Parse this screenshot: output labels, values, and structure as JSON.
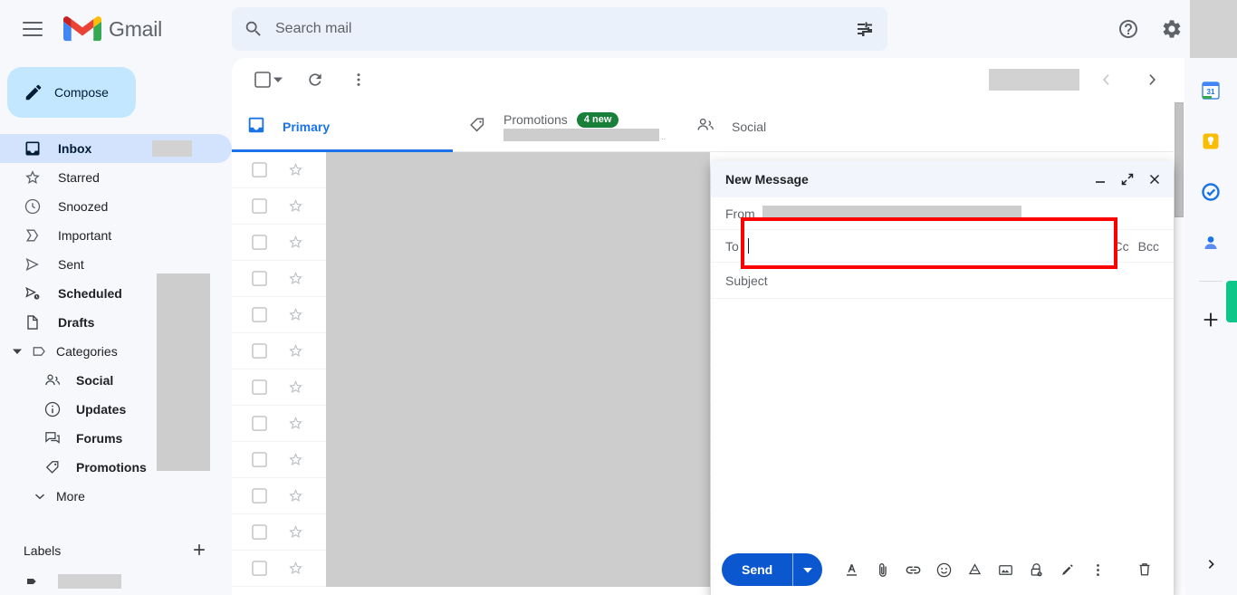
{
  "app": {
    "brand": "Gmail"
  },
  "search": {
    "placeholder": "Search mail",
    "value": "",
    "icon": "search-icon",
    "filter_icon": "tune-filter-icon"
  },
  "top_right": {
    "help_icon": "help-circle-icon",
    "settings_icon": "gear-icon",
    "apps_icon": "apps-grid-icon"
  },
  "sidebar": {
    "menu_icon": "hamburger-menu-icon",
    "compose": {
      "label": "Compose",
      "icon": "pencil-icon"
    },
    "items": [
      {
        "label": "Inbox",
        "icon": "inbox-icon",
        "active": true,
        "bold": true,
        "redacted_count": true
      },
      {
        "label": "Starred",
        "icon": "star-outline-icon",
        "active": false,
        "bold": false
      },
      {
        "label": "Snoozed",
        "icon": "clock-icon",
        "active": false,
        "bold": false
      },
      {
        "label": "Important",
        "icon": "important-marker-icon",
        "active": false,
        "bold": false
      },
      {
        "label": "Sent",
        "icon": "send-arrow-icon",
        "active": false,
        "bold": false
      },
      {
        "label": "Scheduled",
        "icon": "scheduled-send-icon",
        "active": false,
        "bold": true
      },
      {
        "label": "Drafts",
        "icon": "draft-document-icon",
        "active": false,
        "bold": true
      }
    ],
    "categories": {
      "label": "Categories",
      "icon": "label-tag-icon",
      "caret": "caret-down-icon"
    },
    "subitems": [
      {
        "label": "Social",
        "icon": "people-icon"
      },
      {
        "label": "Updates",
        "icon": "info-circle-icon"
      },
      {
        "label": "Forums",
        "icon": "forum-icon"
      },
      {
        "label": "Promotions",
        "icon": "label-tag-icon"
      }
    ],
    "more": {
      "label": "More",
      "icon": "chevron-down-icon"
    },
    "labels_header": {
      "label": "Labels",
      "add_icon": "plus-icon"
    },
    "label_row": {
      "icon": "label-solid-icon"
    }
  },
  "list_toolbar": {
    "select_all": {
      "checkbox_icon": "checkbox-empty-icon",
      "caret_icon": "caret-down-icon"
    },
    "refresh_icon": "refresh-icon",
    "more_icon": "more-vertical-icon",
    "prev_icon": "chevron-left-icon",
    "next_icon": "chevron-right-icon"
  },
  "tabs": [
    {
      "label": "Primary",
      "icon": "inbox-tab-icon",
      "active": true,
      "badge": "",
      "has_sub": false
    },
    {
      "label": "Promotions",
      "icon": "label-tag-icon",
      "active": false,
      "badge": "4 new",
      "has_sub": true,
      "sub_dots": ".."
    },
    {
      "label": "Social",
      "icon": "people-icon",
      "active": false,
      "badge": "",
      "has_sub": false
    }
  ],
  "mail_rows": [
    {
      "checkbox_icon": "checkbox-empty-icon",
      "star_icon": "star-outline-icon",
      "important_icon": "important-marker-icon"
    },
    {
      "checkbox_icon": "checkbox-empty-icon",
      "star_icon": "star-outline-icon",
      "important_icon": "important-marker-icon"
    },
    {
      "checkbox_icon": "checkbox-empty-icon",
      "star_icon": "star-outline-icon",
      "important_icon": "important-marker-icon"
    },
    {
      "checkbox_icon": "checkbox-empty-icon",
      "star_icon": "star-outline-icon",
      "important_icon": "important-marker-icon"
    },
    {
      "checkbox_icon": "checkbox-empty-icon",
      "star_icon": "star-outline-icon",
      "important_icon": "important-marker-icon"
    },
    {
      "checkbox_icon": "checkbox-empty-icon",
      "star_icon": "star-outline-icon",
      "important_icon": "important-marker-icon"
    },
    {
      "checkbox_icon": "checkbox-empty-icon",
      "star_icon": "star-outline-icon",
      "important_icon": "important-marker-icon"
    },
    {
      "checkbox_icon": "checkbox-empty-icon",
      "star_icon": "star-outline-icon",
      "important_icon": "important-marker-icon"
    },
    {
      "checkbox_icon": "checkbox-empty-icon",
      "star_icon": "star-outline-icon",
      "important_icon": "important-marker-icon"
    },
    {
      "checkbox_icon": "checkbox-empty-icon",
      "star_icon": "star-outline-icon",
      "important_icon": "important-marker-icon"
    },
    {
      "checkbox_icon": "checkbox-empty-icon",
      "star_icon": "star-outline-icon",
      "important_icon": "important-marker-icon"
    },
    {
      "checkbox_icon": "checkbox-empty-icon",
      "star_icon": "star-outline-icon",
      "important_icon": "important-marker-icon"
    }
  ],
  "compose": {
    "title": "New Message",
    "minimize_icon": "minimize-icon",
    "popout_icon": "popout-expand-icon",
    "close_icon": "close-x-icon",
    "from_label": "From",
    "to_label": "To",
    "to_value": "",
    "cc_label": "Cc",
    "bcc_label": "Bcc",
    "subject_placeholder": "Subject",
    "subject_value": "",
    "body_value": "",
    "footer": {
      "send_label": "Send",
      "send_options_icon": "caret-down-icon",
      "format_icon": "format-text-icon",
      "attach_icon": "paperclip-icon",
      "link_icon": "link-icon",
      "emoji_icon": "emoji-smile-icon",
      "drive_icon": "google-drive-icon",
      "image_icon": "insert-photo-icon",
      "confidential_icon": "confidential-lock-icon",
      "signature_icon": "pen-signature-icon",
      "more_icon": "more-vertical-icon",
      "discard_icon": "trash-delete-icon"
    }
  },
  "right_rail": {
    "items": [
      {
        "name": "google-calendar-icon",
        "label": "Calendar"
      },
      {
        "name": "google-keep-icon",
        "label": "Keep"
      },
      {
        "name": "google-tasks-icon",
        "label": "Tasks"
      },
      {
        "name": "google-contacts-icon",
        "label": "Contacts"
      }
    ],
    "add_icon": "plus-icon",
    "expand_icon": "chevron-right-icon"
  },
  "annotation": {
    "highlight_color": "#ff0000",
    "target": "to-field"
  }
}
